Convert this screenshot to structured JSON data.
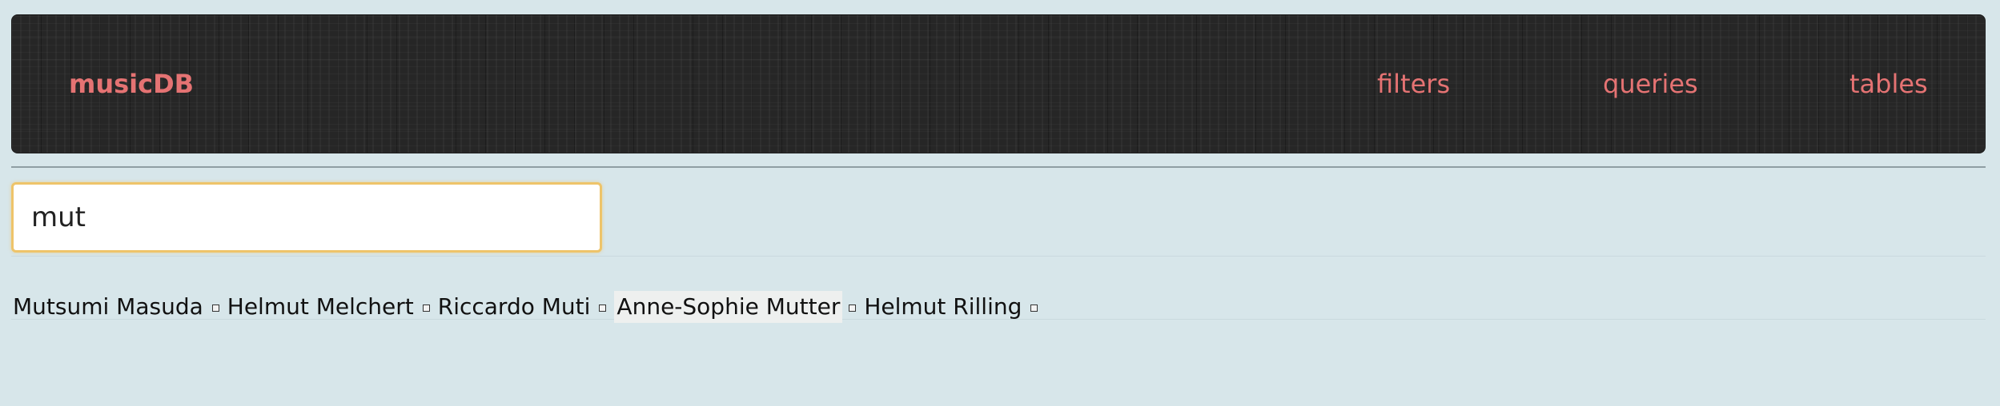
{
  "navbar": {
    "brand": "musicDB",
    "links": [
      "filters",
      "queries",
      "tables"
    ]
  },
  "search": {
    "value": "mut",
    "placeholder": ""
  },
  "results": [
    {
      "name": "Mutsumi Masuda",
      "highlighted": false
    },
    {
      "name": "Helmut Melchert",
      "highlighted": false
    },
    {
      "name": "Riccardo Muti",
      "highlighted": false
    },
    {
      "name": "Anne-Sophie Mutter",
      "highlighted": true
    },
    {
      "name": "Helmut Rilling",
      "highlighted": false
    }
  ],
  "separator_icon": "small-square-icon",
  "colors": {
    "accent": "#e57373",
    "background": "#d7e6ea",
    "navbar": "#262626",
    "input_focus_border": "#eec46a"
  }
}
